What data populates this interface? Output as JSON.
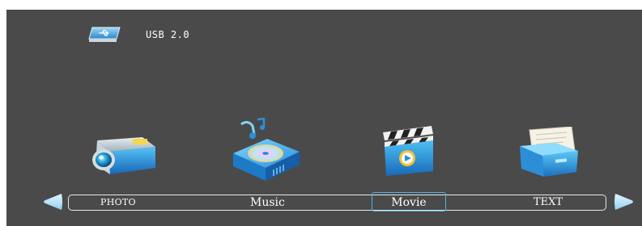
{
  "device": {
    "icon": "usb-drive-icon",
    "label": "USB 2.0"
  },
  "menu": {
    "items": [
      {
        "label": "PHOTO",
        "icon": "photo-camera-icon"
      },
      {
        "label": "Music",
        "icon": "music-disc-icon"
      },
      {
        "label": "Movie",
        "icon": "movie-clapper-icon"
      },
      {
        "label": "TEXT",
        "icon": "text-folder-icon"
      }
    ],
    "selected": "Movie",
    "nav_left_icon": "arrow-left-icon",
    "nav_right_icon": "arrow-right-icon"
  },
  "colors": {
    "background": "#4a4a4a",
    "selection_border": "#4fb6e6",
    "icon_blue": "#2a9fe6",
    "text": "#ffffff"
  }
}
